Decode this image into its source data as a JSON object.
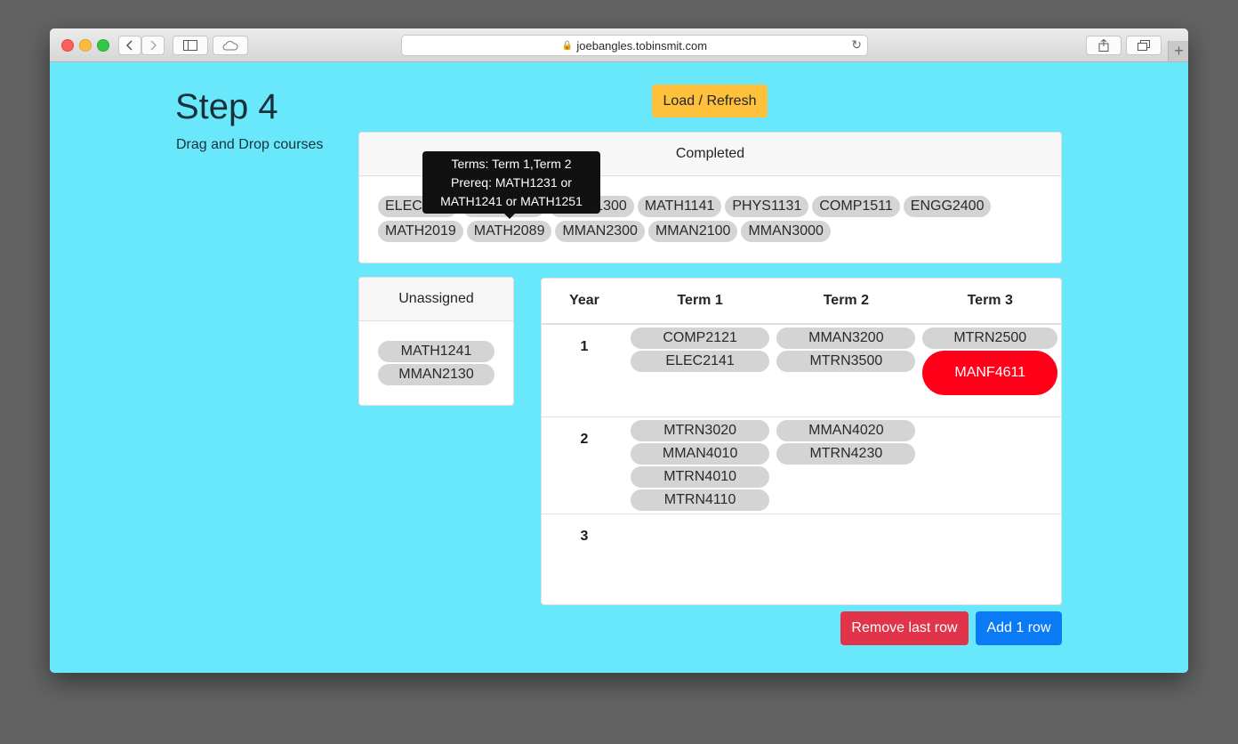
{
  "browser": {
    "url": "joebangles.tobinsmit.com"
  },
  "page": {
    "title": "Step 4",
    "subtitle": "Drag and Drop courses",
    "load_button": "Load / Refresh"
  },
  "completed": {
    "header": "Completed",
    "courses": [
      "ELEC1111",
      "DPST1061",
      "MATH1300",
      "MATH1141",
      "PHYS1131",
      "COMP1511",
      "ENGG2400",
      "MATH2019",
      "MATH2089",
      "MMAN2300",
      "MMAN2100",
      "MMAN3000"
    ]
  },
  "tooltip": {
    "line1": "Terms: Term 1,Term 2",
    "line2": "Prereq: MATH1231 or",
    "line3": "MATH1241 or MATH1251"
  },
  "unassigned": {
    "header": "Unassigned",
    "courses": [
      "MATH1241",
      "MMAN2130"
    ]
  },
  "plan": {
    "headers": {
      "year": "Year",
      "term1": "Term 1",
      "term2": "Term 2",
      "term3": "Term 3"
    },
    "rows": [
      {
        "year": "1",
        "term1": [
          "COMP2121",
          "ELEC2141"
        ],
        "term2": [
          "MMAN3200",
          "MTRN3500"
        ],
        "term3": [
          "MTRN2500",
          "MANF4611"
        ]
      },
      {
        "year": "2",
        "term1": [
          "MTRN3020",
          "MMAN4010",
          "MTRN4010",
          "MTRN4110"
        ],
        "term2": [
          "MMAN4020",
          "MTRN4230"
        ],
        "term3": []
      },
      {
        "year": "3",
        "term1": [],
        "term2": [],
        "term3": []
      }
    ],
    "alert_course": "MANF4611",
    "alert_color": "#ff0018"
  },
  "actions": {
    "remove_row": "Remove last row",
    "add_row": "Add 1 row"
  },
  "colors": {
    "page_bg": "#6ae8fb",
    "warning": "#ffc03c",
    "danger": "#e1344a",
    "primary": "#0a7bf5",
    "chip": "#d4d4d4"
  }
}
